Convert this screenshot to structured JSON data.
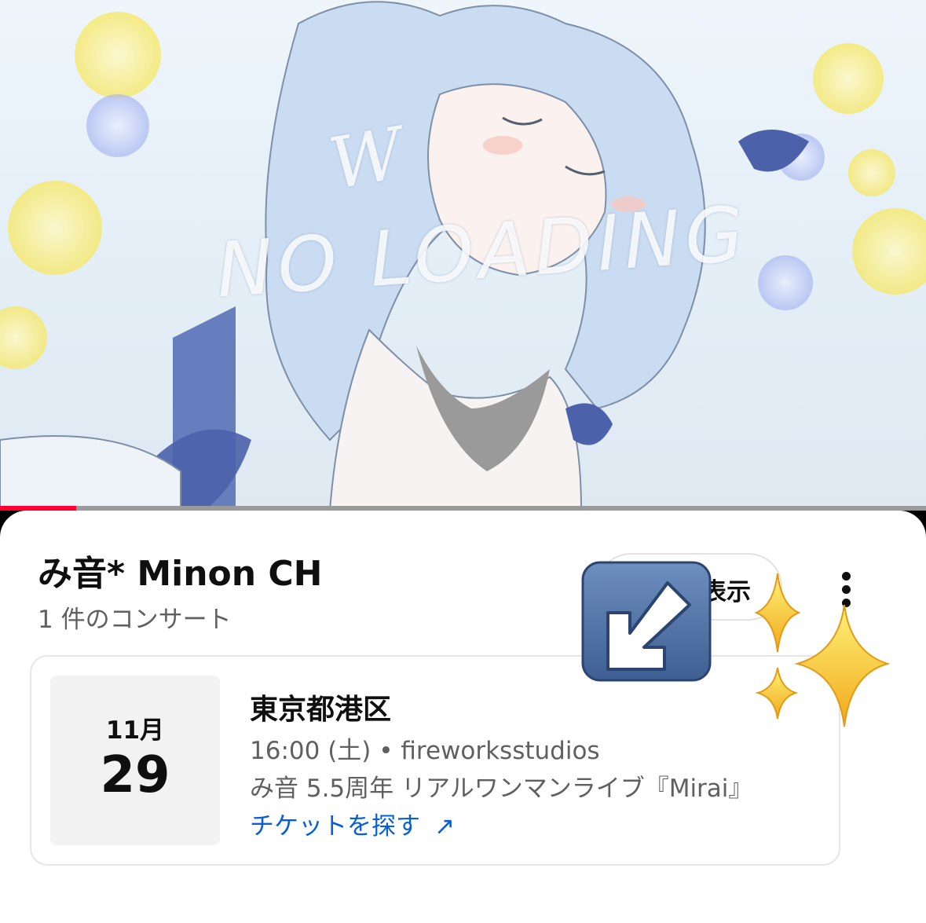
{
  "video": {
    "overlay_text_top": "W",
    "overlay_text_main": "NO LOADING",
    "progress": 0.082,
    "progress_color": "#ff0033"
  },
  "channel": {
    "title": "み音* Minon CH",
    "concert_count": "1 件のコンサート",
    "show_button_label": "表示"
  },
  "event": {
    "month": "11月",
    "day": "29",
    "location": "東京都港区",
    "time_venue": "16:00 (土) • fireworksstudios",
    "title": "み音 5.5周年 リアルワンマンライブ『Mirai』",
    "ticket_link": "チケットを探す",
    "ticket_icon": "↗"
  },
  "icons": {
    "more": "more-vert-icon",
    "arrow": "arrow-down-left-icon",
    "sparkles": "sparkles-icon"
  },
  "colors": {
    "link": "#065fd4",
    "text_primary": "#0f0f0f",
    "text_secondary": "#606060"
  }
}
